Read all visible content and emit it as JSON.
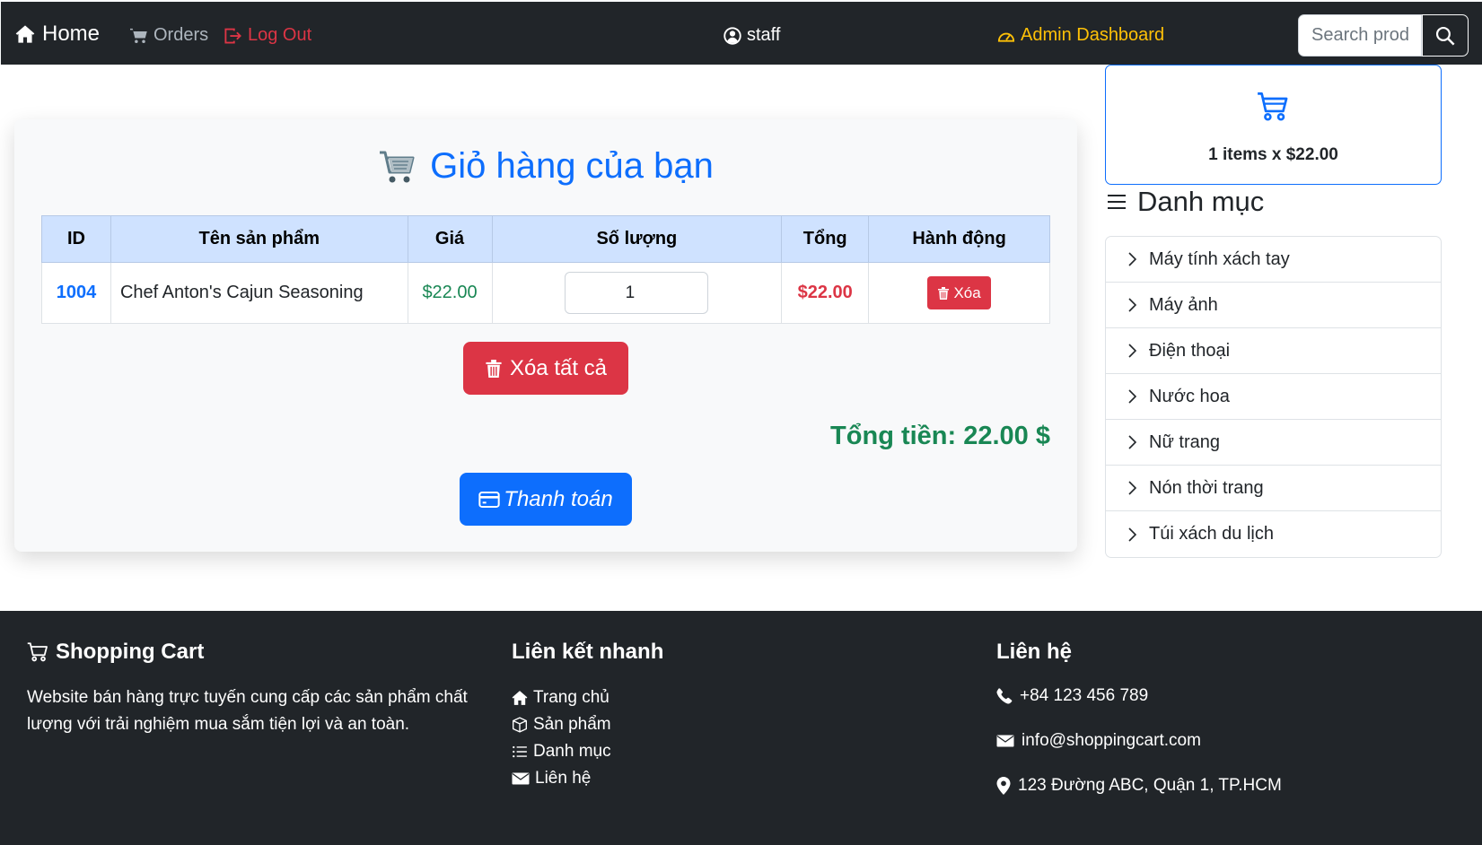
{
  "nav": {
    "home": "Home",
    "orders": "Orders",
    "logout": "Log Out",
    "user": "staff",
    "admin": "Admin Dashboard",
    "search_placeholder": "Search prod"
  },
  "cart": {
    "title": "Giỏ hàng của bạn",
    "headers": [
      "ID",
      "Tên sản phẩm",
      "Giá",
      "Số lượng",
      "Tổng",
      "Hành động"
    ],
    "rows": [
      {
        "id": "1004",
        "name": "Chef Anton's Cajun Seasoning",
        "price": "$22.00",
        "quantity": "1",
        "total": "$22.00",
        "action": "Xóa"
      }
    ],
    "clear_all": "Xóa tất cả",
    "grand_total": "Tổng tiền: 22.00 $",
    "checkout": "Thanh toán"
  },
  "mini_cart": {
    "summary": "1 items x $22.00"
  },
  "categories": {
    "heading": "Danh mục",
    "items": [
      "Máy tính xách tay",
      "Máy ảnh",
      "Điện thoại",
      "Nước hoa",
      "Nữ trang",
      "Nón thời trang",
      "Túi xách du lịch"
    ]
  },
  "footer": {
    "brand": "Shopping Cart",
    "description": "Website bán hàng trực tuyến cung cấp các sản phẩm chất lượng với trải nghiệm mua sắm tiện lợi và an toàn.",
    "links_heading": "Liên kết nhanh",
    "links": [
      "Trang chủ",
      "Sản phẩm",
      "Danh mục",
      "Liên hệ"
    ],
    "contact_heading": "Liên hệ",
    "phone": "+84 123 456 789",
    "email": "info@shoppingcart.com",
    "address": "123 Đường ABC, Quận 1, TP.HCM"
  },
  "colors": {
    "navbar": "#212529",
    "primary": "#0d6efd",
    "danger": "#dc3545",
    "success": "#198754",
    "warning": "#ffc107",
    "table_header": "#cfe2ff"
  }
}
